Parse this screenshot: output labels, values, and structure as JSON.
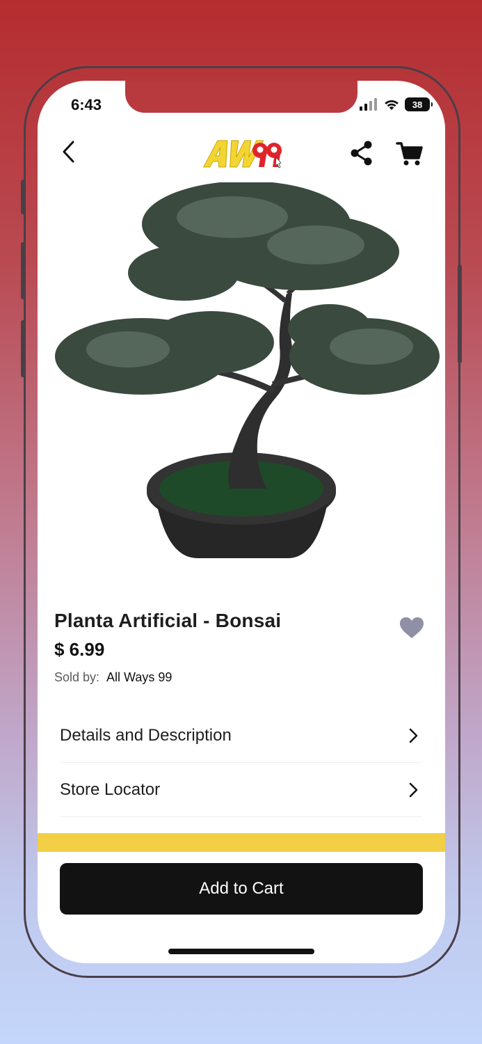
{
  "status_bar": {
    "time": "6:43",
    "battery": "38",
    "icons": [
      "cellular-signal-icon",
      "wifi-icon",
      "battery-icon"
    ]
  },
  "header": {
    "logo_text": "AW99",
    "icons": [
      "back-chevron-icon",
      "share-icon",
      "cart-icon"
    ]
  },
  "product": {
    "image_alt": "bonsai-tree-image",
    "title": "Planta Artificial - Bonsai",
    "price": "$ 6.99",
    "sold_by_label": "Sold by:",
    "seller": "All Ways 99",
    "favorite_icon": "heart-icon"
  },
  "sections": [
    {
      "label": "Details and Description"
    },
    {
      "label": "Store Locator"
    }
  ],
  "actions": {
    "add_to_cart": "Add to Cart"
  },
  "colors": {
    "accent_yellow": "#f2cf45",
    "button_dark": "#121212",
    "heart_gray": "#8f90a6",
    "logo_yellow": "#f2d533",
    "logo_red": "#e0242c"
  }
}
